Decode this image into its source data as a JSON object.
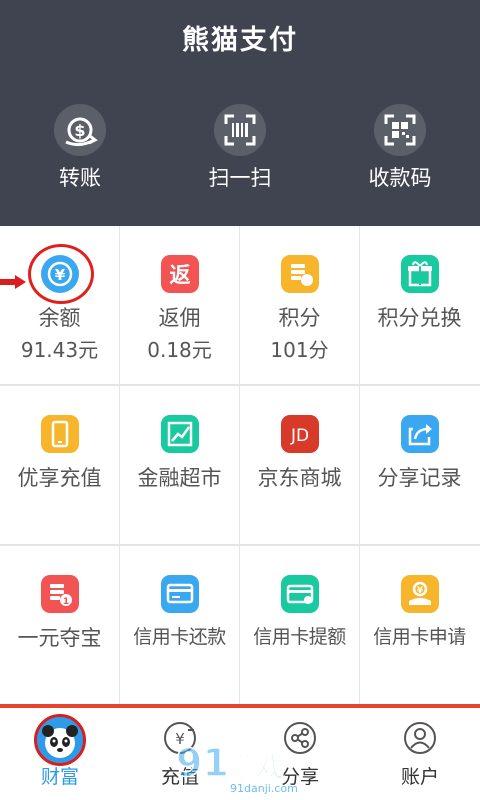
{
  "header": {
    "title": "熊猫支付",
    "background_color": "#3f4450",
    "actions": [
      {
        "label": "转账",
        "icon": "transfer-icon"
      },
      {
        "label": "扫一扫",
        "icon": "scan-icon"
      },
      {
        "label": "收款码",
        "icon": "qr-code-icon"
      }
    ]
  },
  "grid": {
    "cells": [
      {
        "name": "余额",
        "value": "91.43元",
        "icon": "balance-icon",
        "color": "#3aa8f0"
      },
      {
        "name": "返佣",
        "value": "0.18元",
        "icon": "rebate-icon",
        "color": "#f25454"
      },
      {
        "name": "积分",
        "value": "101分",
        "icon": "points-icon",
        "color": "#f7b52c"
      },
      {
        "name": "积分兑换",
        "icon": "gift-icon",
        "color": "#19c9a0"
      },
      {
        "name": "优享充值",
        "icon": "phone-icon",
        "color": "#f7b52c"
      },
      {
        "name": "金融超市",
        "icon": "chart-icon",
        "color": "#19c9a0"
      },
      {
        "name": "京东商城",
        "icon": "jd-icon",
        "icon_text": "JD",
        "color": "#d83a2a"
      },
      {
        "name": "分享记录",
        "icon": "share-icon",
        "color": "#3aa8f0"
      },
      {
        "name": "一元夺宝",
        "icon": "treasure-icon",
        "color": "#f25454"
      },
      {
        "name": "信用卡还款",
        "icon": "card-repay-icon",
        "color": "#3aa8f0"
      },
      {
        "name": "信用卡提额",
        "icon": "card-limit-icon",
        "color": "#19c9a0"
      },
      {
        "name": "信用卡申请",
        "icon": "card-apply-icon",
        "color": "#f7b52c"
      }
    ]
  },
  "tabbar": {
    "accent_color": "#2f9be8",
    "tabs": [
      {
        "label": "财富",
        "icon": "panda-icon",
        "active": true
      },
      {
        "label": "充值",
        "icon": "yen-icon"
      },
      {
        "label": "分享",
        "icon": "share-nodes-icon"
      },
      {
        "label": "账户",
        "icon": "user-icon"
      }
    ]
  },
  "watermark": {
    "text": "游戏",
    "number": "91",
    "domain": "91danji.com"
  }
}
